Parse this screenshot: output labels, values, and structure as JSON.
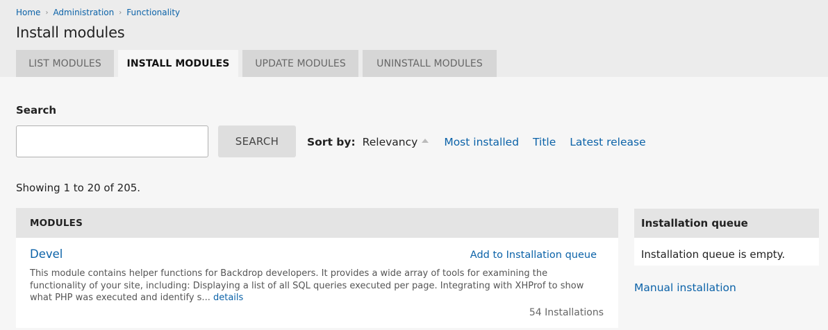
{
  "breadcrumb": {
    "items": [
      "Home",
      "Administration",
      "Functionality"
    ],
    "separator": "›"
  },
  "page_title": "Install modules",
  "tabs": [
    {
      "label": "LIST MODULES",
      "active": false
    },
    {
      "label": "INSTALL MODULES",
      "active": true
    },
    {
      "label": "UPDATE MODULES",
      "active": false
    },
    {
      "label": "UNINSTALL MODULES",
      "active": false
    }
  ],
  "search": {
    "label": "Search",
    "value": "",
    "button_label": "SEARCH"
  },
  "sort": {
    "label": "Sort by:",
    "current": "Relevancy",
    "options": [
      "Most installed",
      "Title",
      "Latest release"
    ]
  },
  "results": {
    "showing_text": "Showing 1 to 20 of 205."
  },
  "modules_panel": {
    "header": "MODULES",
    "items": [
      {
        "name": "Devel",
        "add_label": "Add to Installation queue",
        "description": "This module contains helper functions for Backdrop developers. It provides a wide array of tools for examining the functionality of your site, including: Displaying a list of all SQL queries executed per page. Integrating with XHProf to show what PHP was executed and identify s...",
        "details_label": "details",
        "installs": "54 Installations"
      }
    ]
  },
  "queue": {
    "header": "Installation queue",
    "empty_text": "Installation queue is empty.",
    "manual_link": "Manual installation"
  },
  "colors": {
    "link": "#0b62a8",
    "header_bg": "#ececec",
    "tab_bg": "#d6d6d6",
    "page_bg": "#f6f6f6"
  }
}
